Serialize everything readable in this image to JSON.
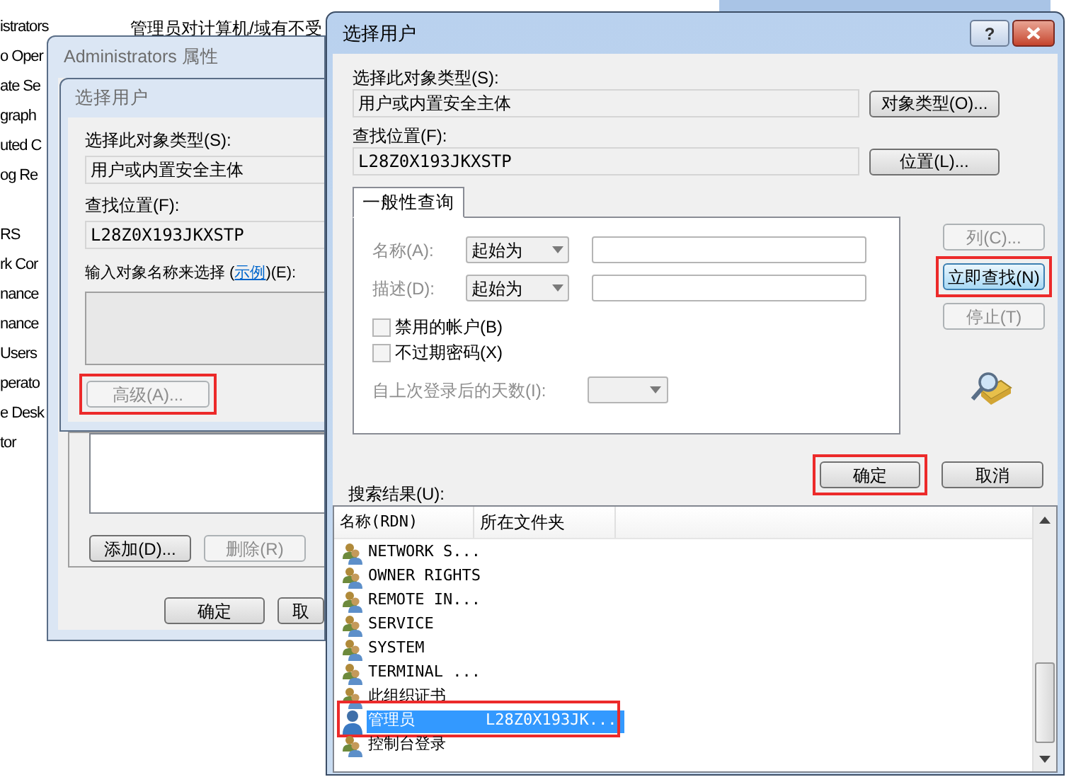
{
  "background": {
    "description_cell": "管理员对计算机/域有不受",
    "list_groups": [
      [
        "istrators",
        "o Oper",
        "ate Se",
        "graph",
        "uted C",
        "og Re"
      ],
      [
        "RS",
        "rk Cor",
        "nance",
        "nance",
        "Users",
        "perato",
        "e Desk",
        "tor"
      ]
    ]
  },
  "properties_window": {
    "title": "Administrators 属性",
    "member_buttons": [
      {
        "label": "添加(D)...",
        "disabled": false
      },
      {
        "label": "删除(R)",
        "disabled": true
      }
    ],
    "footer_buttons": [
      {
        "label": "确定"
      },
      {
        "label": "取"
      }
    ]
  },
  "behind_dialog": {
    "title": "选择用户",
    "object_type_label": "选择此对象类型(S):",
    "object_type": "用户或内置安全主体",
    "location_label": "查找位置(F):",
    "location": "L28Z0X193JKXSTP",
    "names_label_before": "输入对象名称来选择 (",
    "names_link": "示例",
    "names_label_after": ")(E):",
    "advanced_button": {
      "label": "高级(A)...",
      "disabled": true,
      "highlighted": true
    }
  },
  "dialog": {
    "title": "选择用户",
    "help_button": "?",
    "object_type_label": "选择此对象类型(S):",
    "object_type": "用户或内置安全主体",
    "object_types_button": "对象类型(O)...",
    "location_label": "查找位置(F):",
    "location": "L28Z0X193JKXSTP",
    "locations_button": "位置(L)...",
    "tabs": [
      {
        "label": "一般性查询",
        "selected": true
      }
    ],
    "query_rows": [
      {
        "label": "名称(A):",
        "mode": "起始为"
      },
      {
        "label": "描述(D):",
        "mode": "起始为"
      }
    ],
    "checkboxes": [
      {
        "label": "禁用的帐户(B)",
        "checked": false
      },
      {
        "label": "不过期密码(X)",
        "checked": false
      }
    ],
    "days_label": "自上次登录后的天数(I):",
    "side_buttons": [
      {
        "label": "列(C)...",
        "disabled": true,
        "focused": false,
        "highlighted": false
      },
      {
        "label": "立即查找(N)",
        "disabled": false,
        "focused": true,
        "highlighted": true
      },
      {
        "label": "停止(T)",
        "disabled": true,
        "focused": false,
        "highlighted": false
      }
    ],
    "action_buttons": [
      {
        "label": "确定",
        "highlighted": true
      },
      {
        "label": "取消",
        "highlighted": false
      }
    ],
    "results_label": "搜索结果(U):",
    "columns": [
      "名称(RDN)",
      "所在文件夹"
    ],
    "rows": [
      {
        "name": "NETWORK S...",
        "kind": "group",
        "selected": false,
        "highlighted": false
      },
      {
        "name": "OWNER RIGHTS",
        "kind": "group",
        "selected": false,
        "highlighted": false
      },
      {
        "name": "REMOTE IN...",
        "kind": "group",
        "selected": false,
        "highlighted": false
      },
      {
        "name": "SERVICE",
        "kind": "group",
        "selected": false,
        "highlighted": false
      },
      {
        "name": "SYSTEM",
        "kind": "group",
        "selected": false,
        "highlighted": false
      },
      {
        "name": "TERMINAL ...",
        "kind": "group",
        "selected": false,
        "highlighted": false
      },
      {
        "name": "此组织证书",
        "kind": "group",
        "selected": false,
        "highlighted": false
      },
      {
        "name": "管理员",
        "folder": "L28Z0X193JK...",
        "kind": "user",
        "selected": true,
        "highlighted": true
      },
      {
        "name": "控制台登录",
        "kind": "group",
        "selected": false,
        "highlighted": false
      }
    ]
  }
}
